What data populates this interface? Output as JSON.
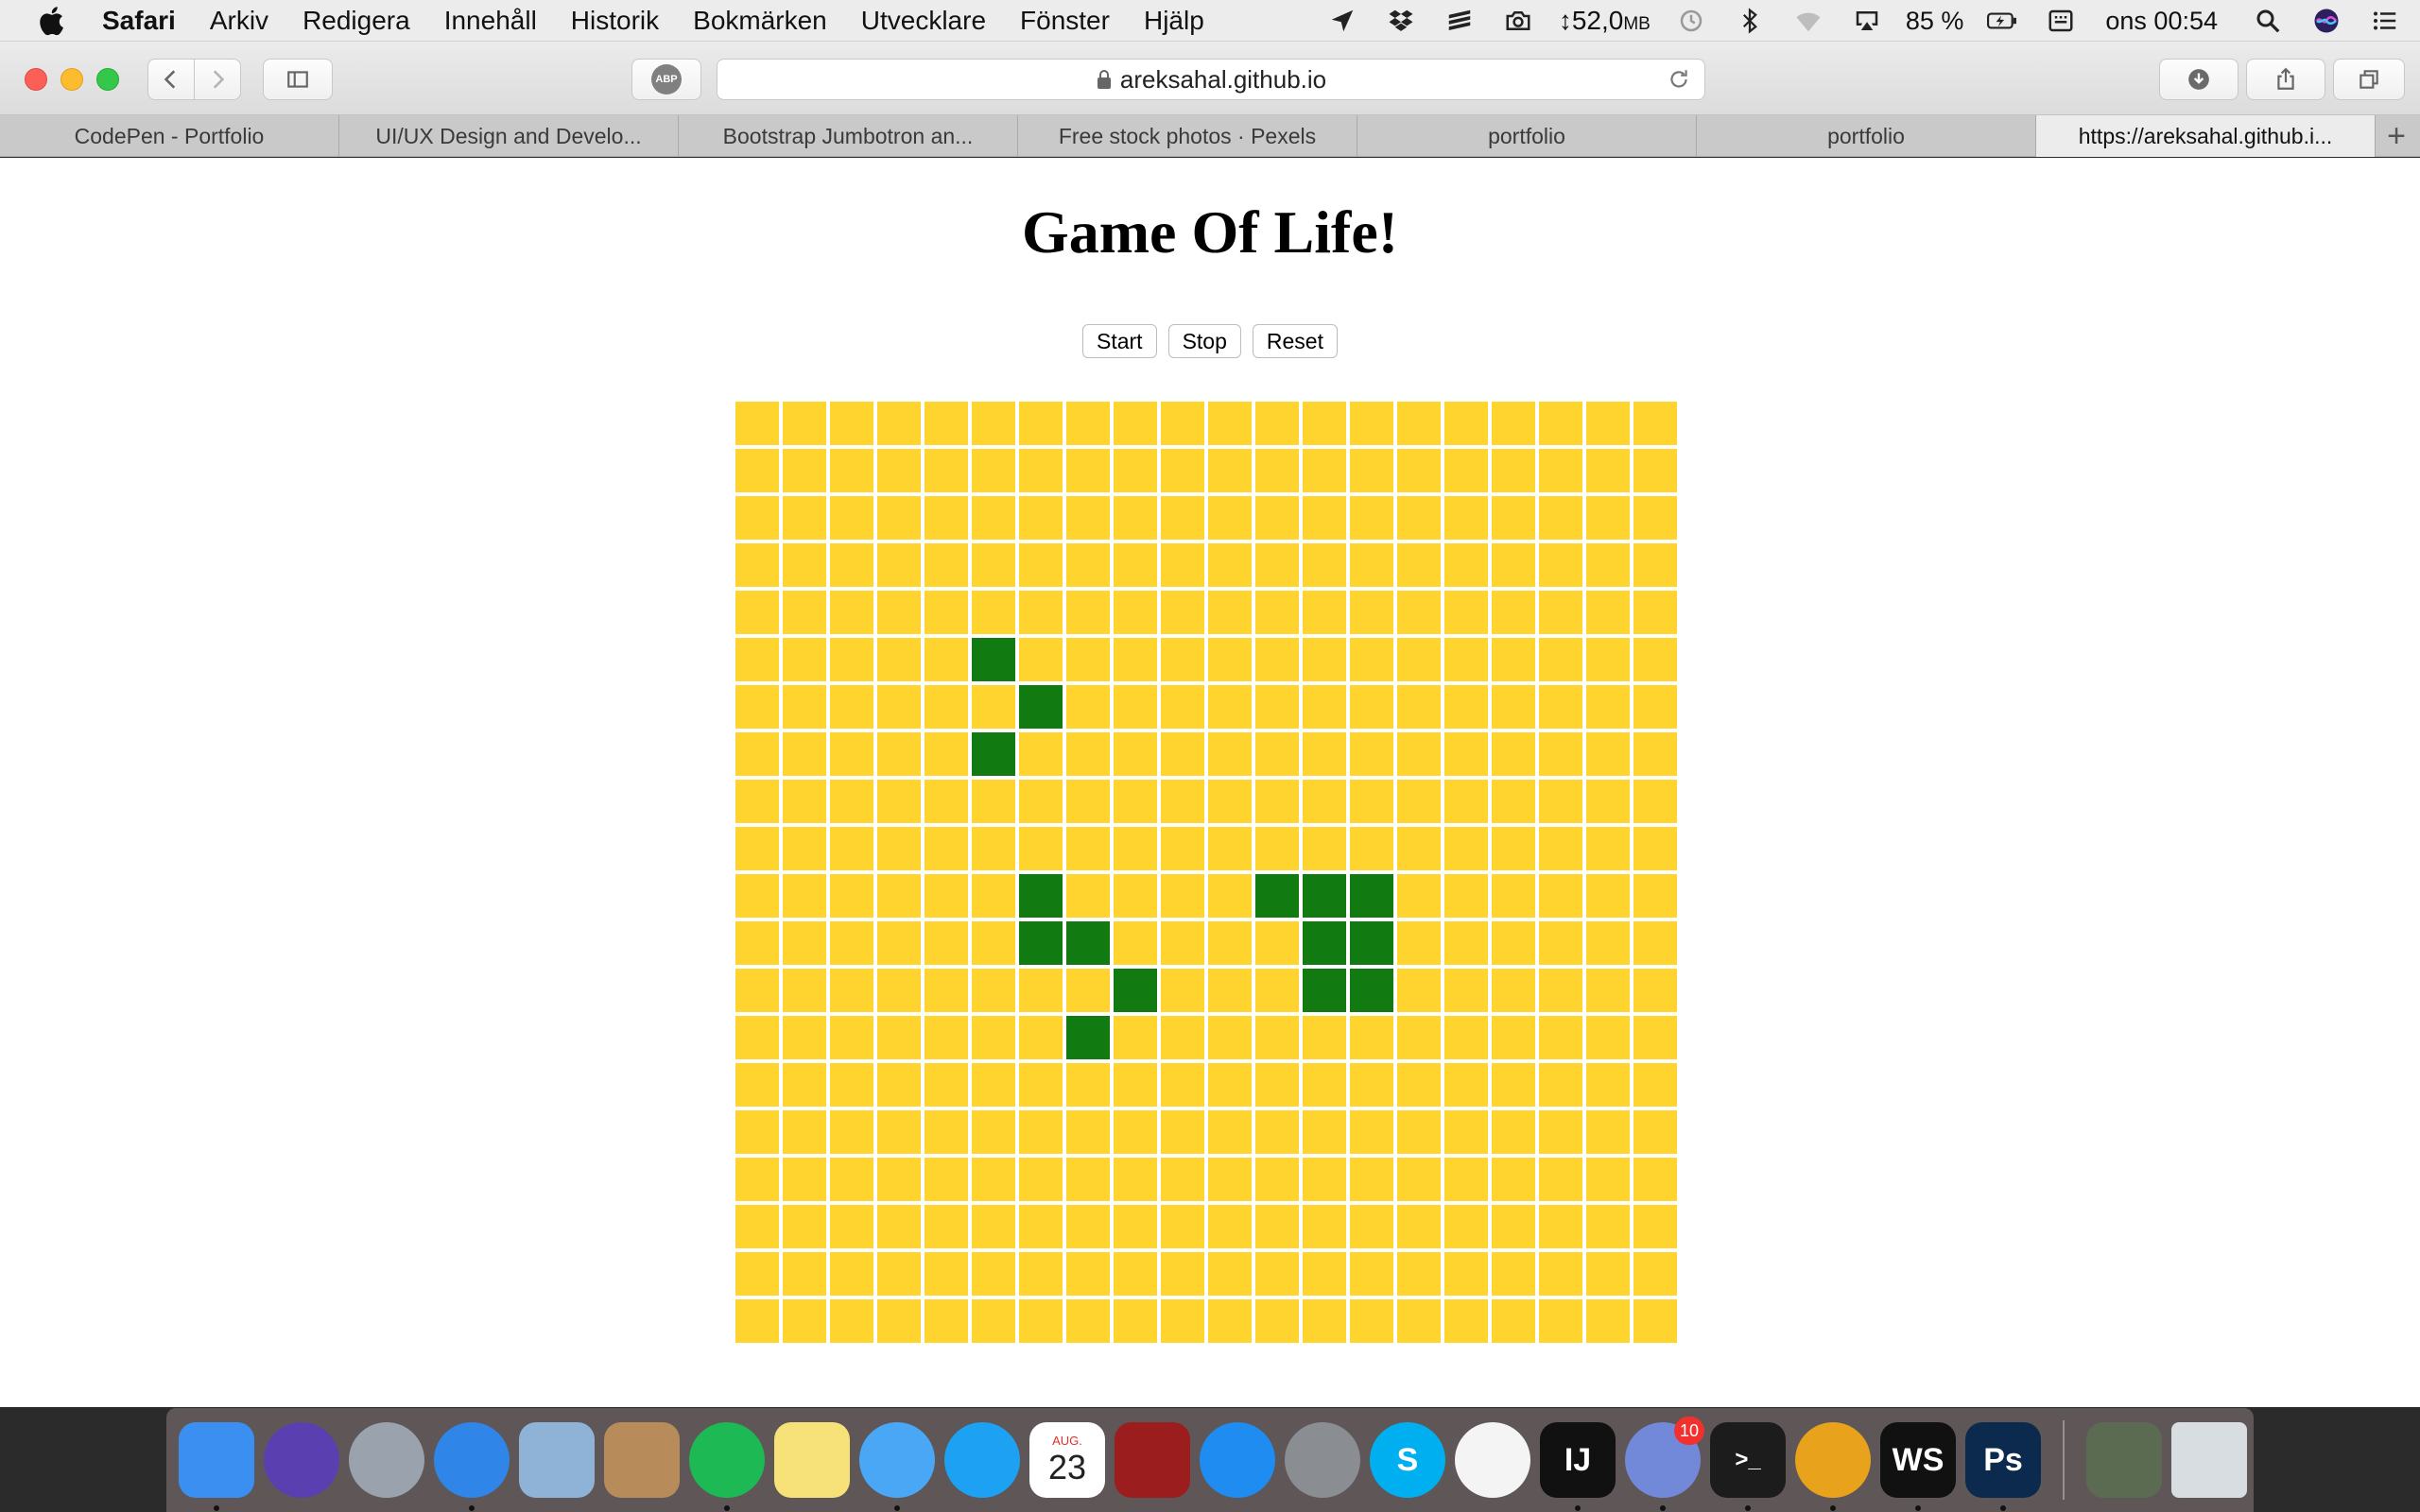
{
  "menubar": {
    "app_name": "Safari",
    "items": [
      "Arkiv",
      "Redigera",
      "Innehåll",
      "Historik",
      "Bokmärken",
      "Utvecklare",
      "Fönster",
      "Hjälp"
    ],
    "memory_value": "↕52,0",
    "memory_unit": "MB",
    "battery_percent": "85 %",
    "clock": "ons 00:54"
  },
  "toolbar": {
    "address": "areksahal.github.io",
    "abp_label": "ABP"
  },
  "tabs": [
    {
      "label": "CodePen - Portfolio"
    },
    {
      "label": "UI/UX Design and Develo..."
    },
    {
      "label": "Bootstrap Jumbotron an..."
    },
    {
      "label": "Free stock photos · Pexels"
    },
    {
      "label": "portfolio"
    },
    {
      "label": "portfolio"
    },
    {
      "label": "https://areksahal.github.i..."
    }
  ],
  "new_tab_label": "+",
  "page": {
    "title": "Game Of Life!",
    "buttons": {
      "start": "Start",
      "stop": "Stop",
      "reset": "Reset"
    },
    "grid": {
      "rows": 20,
      "cols": 20,
      "cell_color": "#ffd42e",
      "alive_color": "#117b11",
      "alive_cells": [
        [
          5,
          5
        ],
        [
          6,
          6
        ],
        [
          7,
          5
        ],
        [
          10,
          6
        ],
        [
          10,
          11
        ],
        [
          10,
          12
        ],
        [
          10,
          13
        ],
        [
          11,
          6
        ],
        [
          11,
          7
        ],
        [
          11,
          12
        ],
        [
          11,
          13
        ],
        [
          12,
          8
        ],
        [
          12,
          12
        ],
        [
          12,
          13
        ],
        [
          13,
          7
        ]
      ]
    }
  },
  "dock": {
    "apps": [
      {
        "name": "Finder",
        "icon": "finder-icon",
        "color": "#3b8ff0",
        "running": true
      },
      {
        "name": "Siri",
        "icon": "siri-icon",
        "color": "#5a3fb0",
        "running": false
      },
      {
        "name": "Launchpad",
        "icon": "rocket-icon",
        "color": "#9aa3ad",
        "running": false
      },
      {
        "name": "Safari",
        "icon": "compass-icon",
        "color": "#2f86e8",
        "running": true
      },
      {
        "name": "Mail",
        "icon": "stamp-icon",
        "color": "#8fb3d6",
        "running": false
      },
      {
        "name": "Contacts",
        "icon": "contacts-icon",
        "color": "#b88c5a",
        "running": false
      },
      {
        "name": "Spotify",
        "icon": "spotify-icon",
        "color": "#1db954",
        "running": true
      },
      {
        "name": "Notes",
        "icon": "notes-icon",
        "color": "#f7e27a",
        "running": false
      },
      {
        "name": "Messages",
        "icon": "speech-bubble-icon",
        "color": "#4aa7f5",
        "running": true
      },
      {
        "name": "Twitter",
        "icon": "bird-icon",
        "color": "#1da1f2",
        "running": false
      },
      {
        "name": "Calendar",
        "icon": "calendar-icon",
        "color": "#ffffff",
        "running": false,
        "label": "23",
        "sublabel": "AUG."
      },
      {
        "name": "Photo Booth",
        "icon": "photobooth-icon",
        "color": "#9b1d1d",
        "running": false
      },
      {
        "name": "App Store",
        "icon": "appstore-icon",
        "color": "#1e8cf0",
        "running": false
      },
      {
        "name": "System Preferences",
        "icon": "gear-icon",
        "color": "#8a8d91",
        "running": false
      },
      {
        "name": "Skype",
        "icon": "skype-icon",
        "color": "#00aff0",
        "running": false,
        "label": "S"
      },
      {
        "name": "Photos",
        "icon": "photos-icon",
        "color": "#f4f4f4",
        "running": false
      },
      {
        "name": "IntelliJ IDEA",
        "icon": "intellij-icon",
        "color": "#111111",
        "running": true,
        "label": "IJ"
      },
      {
        "name": "Discord",
        "icon": "discord-icon",
        "color": "#7289da",
        "running": true,
        "badge": "10"
      },
      {
        "name": "Terminal",
        "icon": "terminal-icon",
        "color": "#1c1c1c",
        "running": true,
        "label": ">_"
      },
      {
        "name": "Chrome",
        "icon": "chrome-icon",
        "color": "#e8a21b",
        "running": true
      },
      {
        "name": "WebStorm",
        "icon": "webstorm-icon",
        "color": "#111111",
        "running": true,
        "label": "WS"
      },
      {
        "name": "Photoshop",
        "icon": "photoshop-icon",
        "color": "#0c2a4d",
        "running": true,
        "label": "Ps"
      }
    ],
    "stack": {
      "name": "Downloads",
      "icon": "folder-stack-icon",
      "color": "#5b6b52"
    },
    "trash": {
      "name": "Trash",
      "icon": "trash-icon",
      "color": "#d8dde1"
    }
  }
}
